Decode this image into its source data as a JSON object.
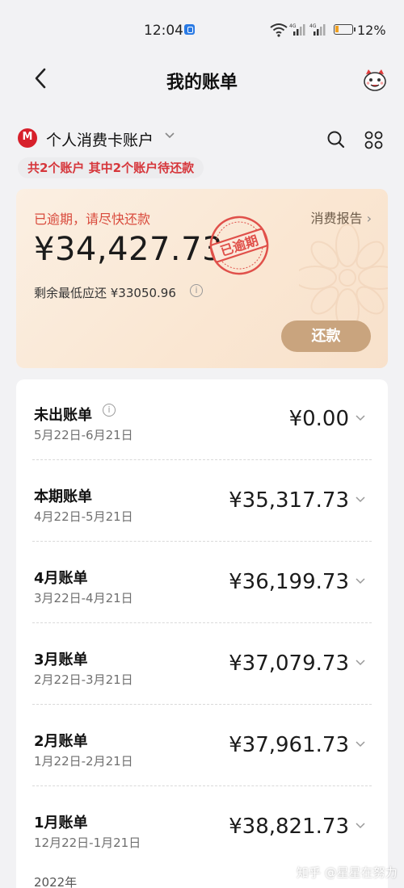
{
  "status_bar": {
    "time": "12:04",
    "battery": "12%",
    "network_labels": [
      "4G",
      "4G"
    ]
  },
  "nav": {
    "title": "我的账单",
    "back_icon": "back-chevron-icon",
    "mascot_icon": "mascot-icon"
  },
  "account": {
    "bank_logo_text": "M",
    "name": "个人消费卡账户",
    "summary_pill": "共2个账户 其中2个账户待还款"
  },
  "overdue_card": {
    "warning": "已逾期，请尽快还款",
    "report_link": "消费报告",
    "amount": "¥34,427.73",
    "stamp_text": "已逾期",
    "min_payment": "剩余最低应还 ¥33050.96",
    "info_glyph": "i",
    "repay_button": "还款"
  },
  "bills": [
    {
      "title": "未出账单",
      "range": "5月22日-6月21日",
      "amount": "¥0.00",
      "has_info": true
    },
    {
      "title": "本期账单",
      "range": "4月22日-5月21日",
      "amount": "¥35,317.73"
    },
    {
      "title": "4月账单",
      "range": "3月22日-4月21日",
      "amount": "¥36,199.73"
    },
    {
      "title": "3月账单",
      "range": "2月22日-3月21日",
      "amount": "¥37,079.73"
    },
    {
      "title": "2月账单",
      "range": "1月22日-2月21日",
      "amount": "¥37,961.73"
    },
    {
      "title": "1月账单",
      "range": "12月22日-1月21日",
      "amount": "¥38,821.73"
    }
  ],
  "year_label": "2022年",
  "watermark": "知乎 @星星在努力",
  "colors": {
    "accent": "#d6363b",
    "repay_button": "#c9a47e",
    "overdue_text": "#d94a3c"
  }
}
